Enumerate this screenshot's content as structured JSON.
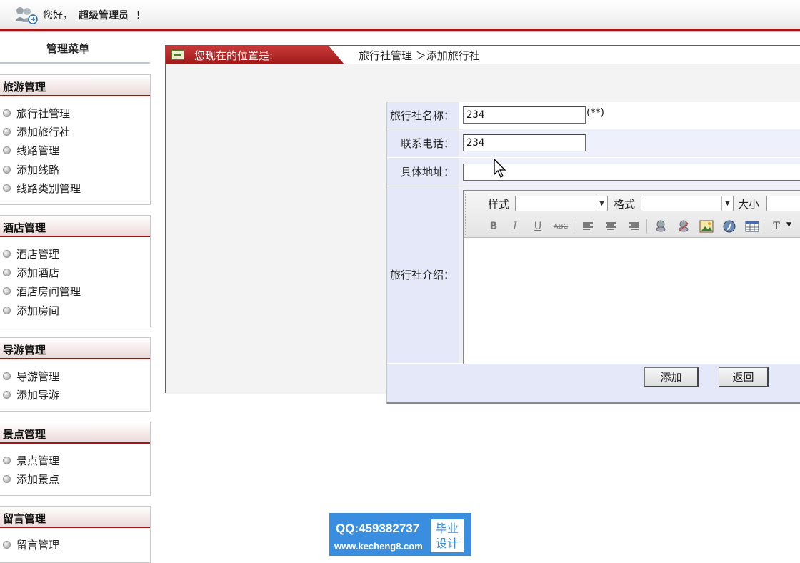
{
  "header": {
    "greeting": "您好，",
    "username": "超级管理员",
    "exclaim": "！"
  },
  "sidebar": {
    "title": "管理菜单",
    "groups": [
      {
        "title": "旅游管理",
        "items": [
          "旅行社管理",
          "添加旅行社",
          "线路管理",
          "添加线路",
          "线路类别管理"
        ]
      },
      {
        "title": "酒店管理",
        "items": [
          "酒店管理",
          "添加酒店",
          "酒店房间管理",
          "添加房间"
        ]
      },
      {
        "title": "导游管理",
        "items": [
          "导游管理",
          "添加导游"
        ]
      },
      {
        "title": "景点管理",
        "items": [
          "景点管理",
          "添加景点"
        ]
      },
      {
        "title": "留言管理",
        "items": [
          "留言管理"
        ]
      }
    ]
  },
  "location": {
    "label": "您现在的位置是:",
    "breadcrumb": "旅行社管理 ＞添加旅行社"
  },
  "form": {
    "name_label": "旅行社名称：",
    "name_value": "234",
    "name_hint": "(**)",
    "phone_label": "联系电话：",
    "phone_value": "234",
    "address_label": "具体地址：",
    "address_value": "",
    "intro_label": "旅行社介绍：",
    "editor": {
      "style_label": "样式",
      "format_label": "格式",
      "size_label": "大小",
      "bold": "B",
      "italic": "I",
      "underline": "U",
      "strike": "ABC",
      "color": "T"
    },
    "submit_label": "添加",
    "back_label": "返回"
  },
  "watermark": {
    "qq": "QQ:459382737",
    "url": "www.kecheng8.com",
    "tag_line1": "毕业",
    "tag_line2": "设计"
  },
  "colors": {
    "accent_red": "#a01616",
    "form_row_bg": "#eef0fc",
    "label_bg": "#e4e8f8",
    "watermark_bg": "#3a8ee0"
  }
}
